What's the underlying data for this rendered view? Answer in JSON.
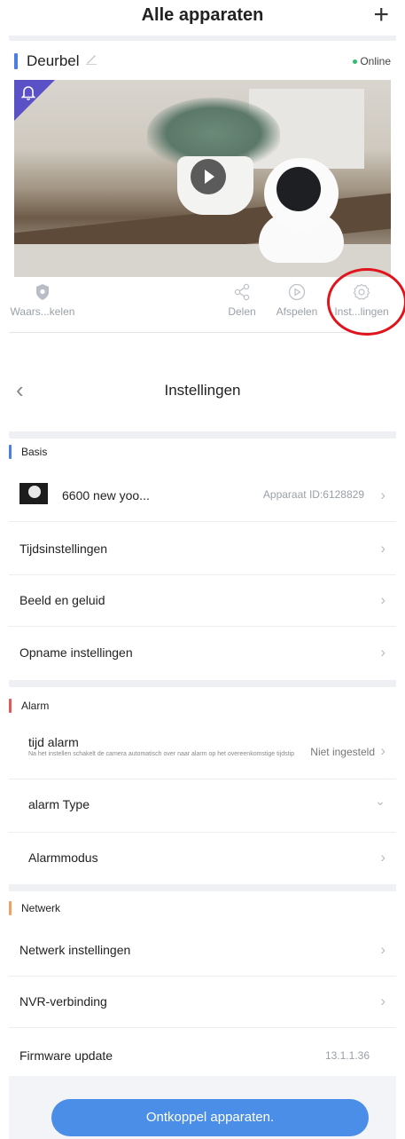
{
  "top": {
    "title": "Alle apparaten",
    "add_icon": "plus-icon"
  },
  "device": {
    "name": "Deurbel",
    "status": "Online",
    "status_color": "#2dbd6e",
    "accent": "#4a7fe0"
  },
  "actions": {
    "left": "Waars...kelen",
    "share": "Delen",
    "play": "Afspelen",
    "settings": "Inst...lingen"
  },
  "settings": {
    "title": "Instellingen",
    "sections": {
      "basis": "Basis",
      "alarm": "Alarm",
      "netwerk": "Netwerk"
    },
    "device_name": "6600 new yoo...",
    "device_id": "Apparaat ID:6128829",
    "time_settings": "Tijdsinstellingen",
    "image_sound": "Beeld en geluid",
    "recording": "Opname instellingen",
    "alarm_time": "tijd alarm",
    "alarm_time_desc": "Na het instellen schakelt de camera automatisch over naar alarm op het overeenkomstige tijdstip",
    "alarm_time_value": "Niet ingesteld",
    "alarm_type": "alarm Type",
    "alarm_mode": "Alarmmodus",
    "network_settings": "Netwerk instellingen",
    "nvr": "NVR-verbinding",
    "firmware": "Firmware update",
    "firmware_version": "13.1.1.36",
    "disconnect": "Ontkoppel apparaten."
  },
  "colors": {
    "basis": "#4a7fe0",
    "alarm": "#e05a5a",
    "netwerk": "#f0a060",
    "highlight": "#e0141c",
    "button": "#4a8ee8"
  }
}
